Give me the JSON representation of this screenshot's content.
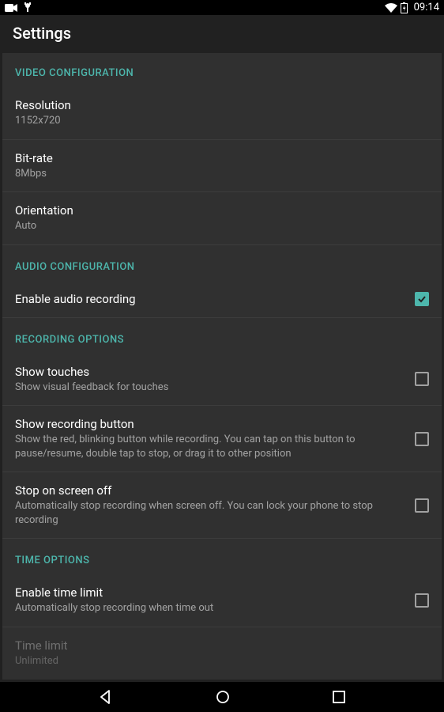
{
  "statusBar": {
    "time": "09:14"
  },
  "appBar": {
    "title": "Settings"
  },
  "sections": {
    "video": {
      "header": "VIDEO CONFIGURATION",
      "resolution": {
        "title": "Resolution",
        "value": "1152x720"
      },
      "bitrate": {
        "title": "Bit-rate",
        "value": "8Mbps"
      },
      "orientation": {
        "title": "Orientation",
        "value": "Auto"
      }
    },
    "audio": {
      "header": "AUDIO CONFIGURATION",
      "enable": {
        "title": "Enable audio recording",
        "checked": true
      }
    },
    "recording": {
      "header": "RECORDING OPTIONS",
      "showTouches": {
        "title": "Show touches",
        "sub": "Show visual feedback for touches",
        "checked": false
      },
      "showButton": {
        "title": "Show recording button",
        "sub": "Show the red, blinking button while recording. You can tap on this button to pause/resume, double tap to stop, or drag it to other position",
        "checked": false
      },
      "stopScreenOff": {
        "title": "Stop on screen off",
        "sub": "Automatically stop recording when screen off. You can lock your phone to stop recording",
        "checked": false
      }
    },
    "time": {
      "header": "TIME OPTIONS",
      "enableLimit": {
        "title": "Enable time limit",
        "sub": "Automatically stop recording when time out",
        "checked": false
      },
      "limit": {
        "title": "Time limit",
        "value": "Unlimited",
        "disabled": true
      }
    }
  }
}
